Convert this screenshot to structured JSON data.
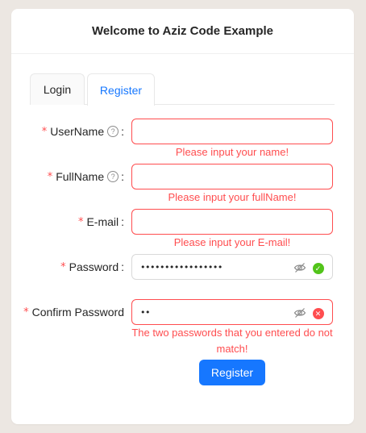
{
  "header": {
    "title": "Welcome to Aziz Code Example"
  },
  "tabs": [
    {
      "label": "Login",
      "active": false
    },
    {
      "label": "Register",
      "active": true
    }
  ],
  "form": {
    "required_mark": "*",
    "help_mark": "?",
    "colon": ":",
    "fields": {
      "username": {
        "label": "UserName",
        "value": "",
        "error": "Please input your name!"
      },
      "fullname": {
        "label": "FullName",
        "value": "",
        "error": "Please input your fullName!"
      },
      "email": {
        "label": "E-mail",
        "value": "",
        "error": "Please input your E-mail!"
      },
      "password": {
        "label": "Password",
        "value": "•••••••••••••••••",
        "status": "success"
      },
      "confirm": {
        "label": "Confirm Password",
        "value": "••",
        "status": "error",
        "error": "The two passwords that you entered do not match!"
      }
    },
    "submit_label": "Register"
  },
  "colors": {
    "primary": "#1677ff",
    "error": "#ff4d4f",
    "success": "#52c41a"
  },
  "icons": {
    "help": "question-circle-icon",
    "eye": "eye-invisible-icon",
    "ok": "check-circle-icon",
    "err": "close-circle-icon"
  }
}
